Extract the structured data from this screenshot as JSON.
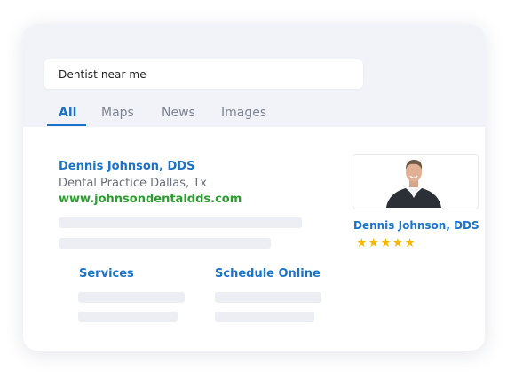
{
  "search": {
    "query": "Dentist near me"
  },
  "tabs": [
    {
      "label": "All"
    },
    {
      "label": "Maps"
    },
    {
      "label": "News"
    },
    {
      "label": "Images"
    }
  ],
  "result": {
    "name": "Dennis Johnson, DDS",
    "description": "Dental Practice Dallas, Tx",
    "url": "www.johnsondentaldds.com",
    "sitelinks": [
      {
        "label": "Services"
      },
      {
        "label": "Schedule Online"
      }
    ]
  },
  "profile": {
    "name": "Dennis Johnson, DDS",
    "stars": "★★★★★",
    "rating_value": 5,
    "rating_max": 5
  },
  "colors": {
    "accent_blue": "#1a73c8",
    "url_green": "#2a9d2e",
    "star_gold": "#f5b800",
    "header_bg": "#f2f3f8"
  }
}
